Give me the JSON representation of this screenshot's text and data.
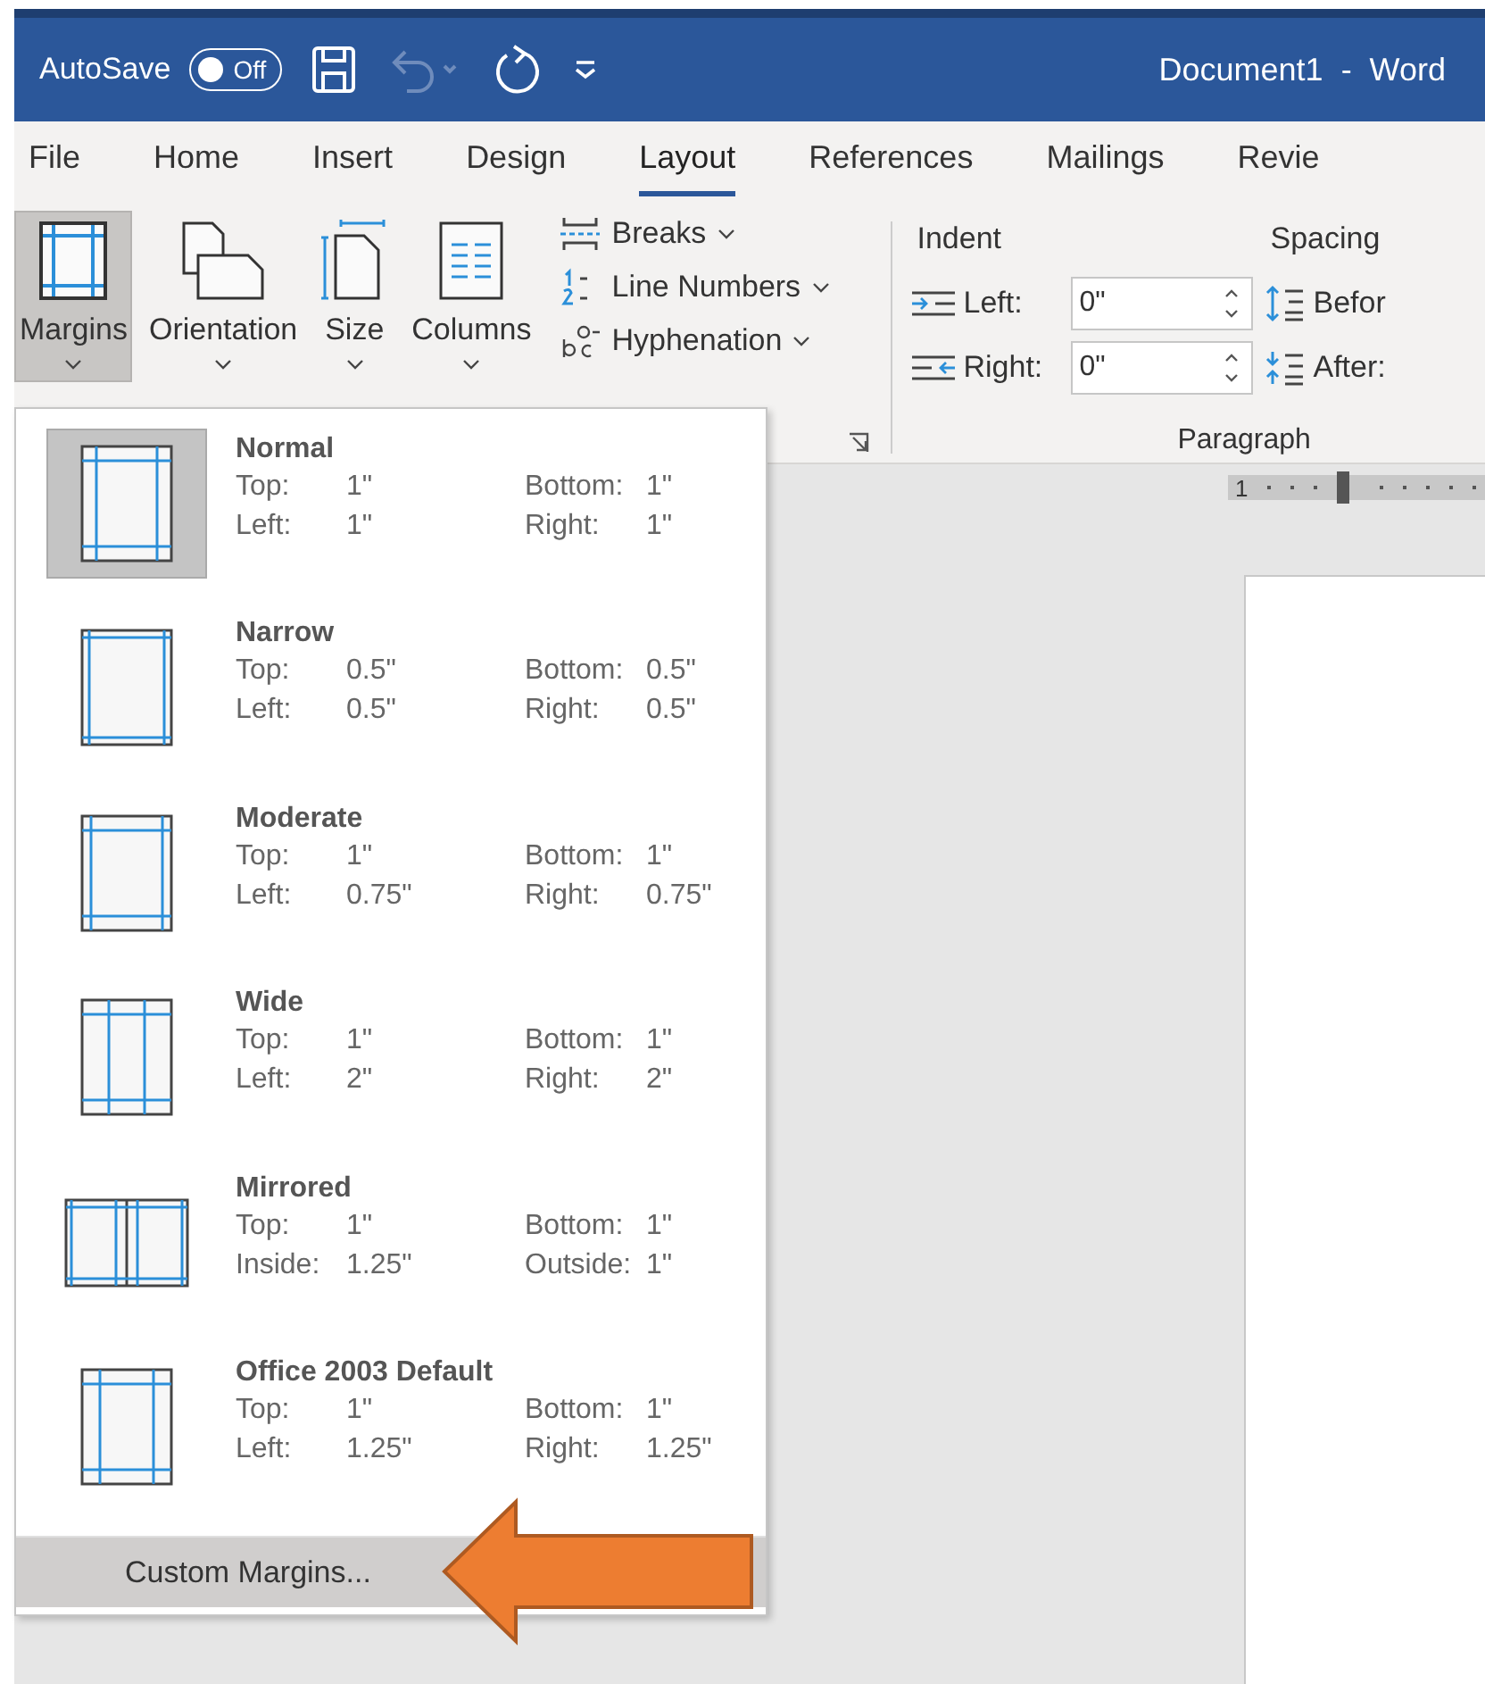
{
  "title_bar": {
    "autosave_label": "AutoSave",
    "autosave_toggle": {
      "label": "Off",
      "on": false
    },
    "undo_disabled": true,
    "document_title": "Document1  -  Word"
  },
  "tabs": [
    {
      "label": "File",
      "selected": false
    },
    {
      "label": "Home",
      "selected": false
    },
    {
      "label": "Insert",
      "selected": false
    },
    {
      "label": "Design",
      "selected": false
    },
    {
      "label": "Layout",
      "selected": true
    },
    {
      "label": "References",
      "selected": false
    },
    {
      "label": "Mailings",
      "selected": false
    },
    {
      "label": "Revie",
      "selected": false
    }
  ],
  "ribbon": {
    "large_buttons": [
      {
        "label": "Margins",
        "kind": "margins",
        "selected": true
      },
      {
        "label": "Orientation",
        "kind": "orientation",
        "selected": false
      },
      {
        "label": "Size",
        "kind": "size",
        "selected": false
      },
      {
        "label": "Columns",
        "kind": "columns",
        "selected": false
      }
    ],
    "small_buttons": [
      {
        "label": "Breaks",
        "kind": "breaks"
      },
      {
        "label": "Line Numbers",
        "kind": "line-numbers"
      },
      {
        "label": "Hyphenation",
        "kind": "hyphenation"
      }
    ],
    "indent": {
      "title": "Indent",
      "rows": [
        {
          "label": "Left:",
          "value": "0\"",
          "kind": "left"
        },
        {
          "label": "Right:",
          "value": "0\"",
          "kind": "right"
        }
      ]
    },
    "spacing": {
      "title": "Spacing",
      "rows": [
        {
          "label": "Befor",
          "kind": "before"
        },
        {
          "label": "After:",
          "kind": "after"
        }
      ]
    },
    "paragraph_label": "Paragraph"
  },
  "ruler": {
    "label": "1"
  },
  "margins_menu": {
    "presets": [
      {
        "name": "Normal",
        "kind": "normal",
        "selected": true,
        "fields": [
          [
            "Top:",
            "1\""
          ],
          [
            "Bottom:",
            "1\""
          ],
          [
            "Left:",
            "1\""
          ],
          [
            "Right:",
            "1\""
          ]
        ]
      },
      {
        "name": "Narrow",
        "kind": "narrow",
        "selected": false,
        "fields": [
          [
            "Top:",
            "0.5\""
          ],
          [
            "Bottom:",
            "0.5\""
          ],
          [
            "Left:",
            "0.5\""
          ],
          [
            "Right:",
            "0.5\""
          ]
        ]
      },
      {
        "name": "Moderate",
        "kind": "moderate",
        "selected": false,
        "fields": [
          [
            "Top:",
            "1\""
          ],
          [
            "Bottom:",
            "1\""
          ],
          [
            "Left:",
            "0.75\""
          ],
          [
            "Right:",
            "0.75\""
          ]
        ]
      },
      {
        "name": "Wide",
        "kind": "wide",
        "selected": false,
        "fields": [
          [
            "Top:",
            "1\""
          ],
          [
            "Bottom:",
            "1\""
          ],
          [
            "Left:",
            "2\""
          ],
          [
            "Right:",
            "2\""
          ]
        ]
      },
      {
        "name": "Mirrored",
        "kind": "mirrored",
        "selected": false,
        "fields": [
          [
            "Top:",
            "1\""
          ],
          [
            "Bottom:",
            "1\""
          ],
          [
            "Inside:",
            "1.25\""
          ],
          [
            "Outside:",
            "1\""
          ]
        ]
      },
      {
        "name": "Office 2003 Default",
        "kind": "office2003",
        "selected": false,
        "fields": [
          [
            "Top:",
            "1\""
          ],
          [
            "Bottom:",
            "1\""
          ],
          [
            "Left:",
            "1.25\""
          ],
          [
            "Right:",
            "1.25\""
          ]
        ]
      }
    ],
    "custom": "Custom Margins..."
  }
}
